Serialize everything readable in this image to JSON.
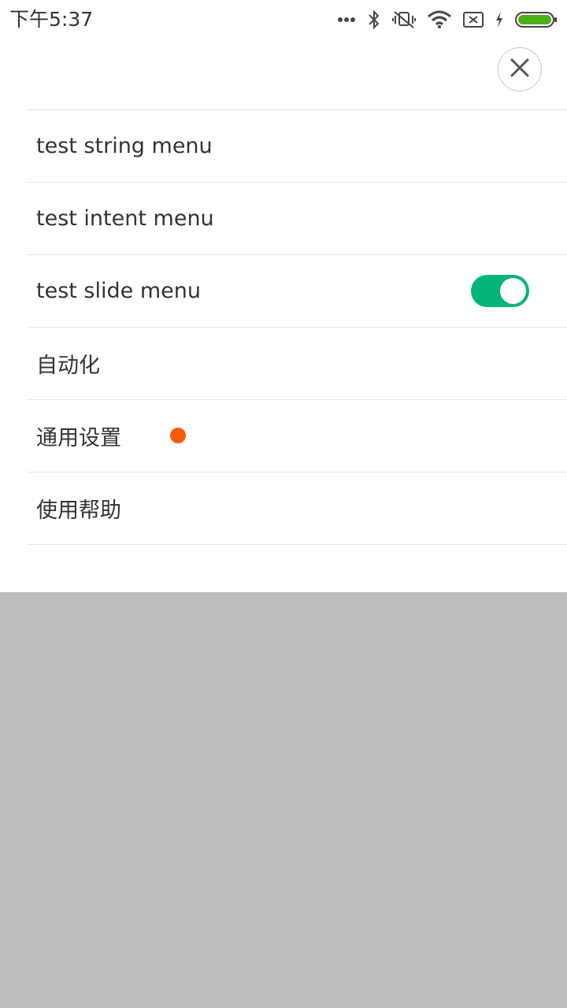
{
  "status_bar": {
    "time": "下午5:37",
    "icons": [
      "more-dots-icon",
      "bluetooth-icon",
      "vibrate-off-icon",
      "wifi-icon",
      "no-sim-icon",
      "charging-icon",
      "battery-icon"
    ],
    "battery_color": "#4caf16"
  },
  "close_button": {
    "icon": "close-icon"
  },
  "menu": {
    "items": [
      {
        "label": "test string menu"
      },
      {
        "label": "test intent menu"
      },
      {
        "label": "test slide menu",
        "toggle": {
          "on": true,
          "color": "#03b47a"
        }
      },
      {
        "label": "自动化"
      },
      {
        "label": "通用设置",
        "badge_color": "#fa5a0a"
      },
      {
        "label": "使用帮助"
      }
    ]
  },
  "colors": {
    "background_dim": "#bdbdbd",
    "sheet": "#ffffff",
    "divider": "#e6e6e6",
    "text": "#333333"
  }
}
